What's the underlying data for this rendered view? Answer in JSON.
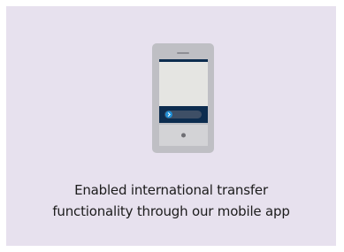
{
  "card": {
    "background": "#e7e1ee",
    "icon": "smartphone-transfer-icon",
    "caption_lines": [
      "Enabled international transfer",
      "functionality through our mobile app"
    ]
  },
  "colors": {
    "phone_body": "#bfbfc4",
    "screen": "#e5e5e2",
    "screen_bar": "#0d2d4f",
    "accent": "#1f8fd6"
  }
}
